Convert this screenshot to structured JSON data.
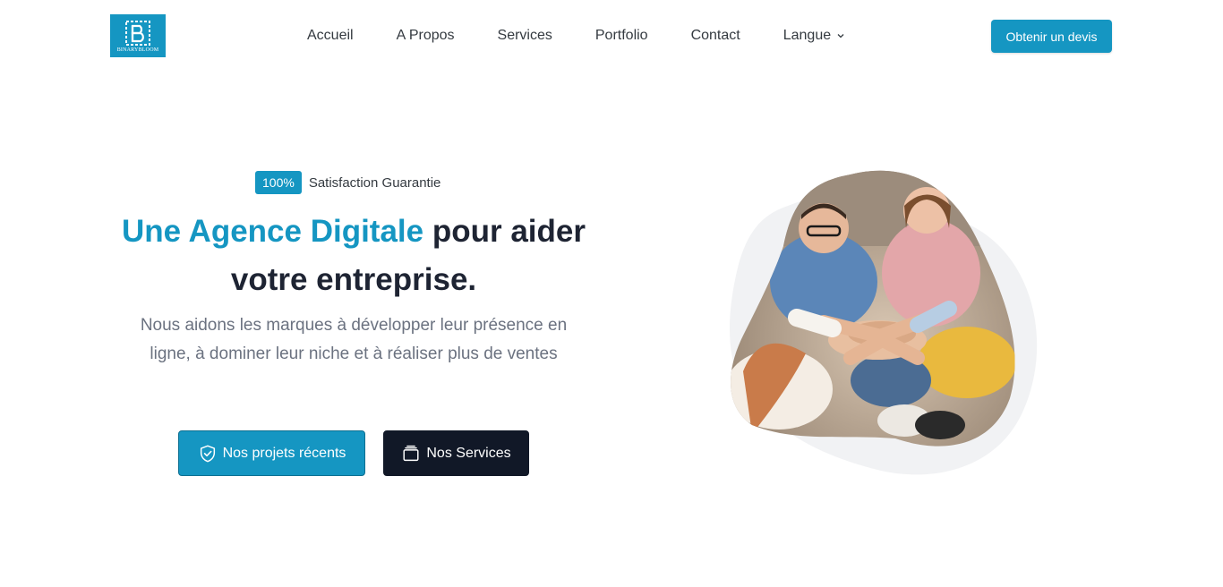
{
  "brand": {
    "logo_text": "BINARYBLOOM",
    "color": "#1596c2"
  },
  "nav": {
    "items": [
      "Accueil",
      "A Propos",
      "Services",
      "Portfolio",
      "Contact"
    ],
    "language_label": "Langue",
    "language_icon": "chevron-down-icon"
  },
  "header": {
    "cta_label": "Obtenir un devis"
  },
  "hero": {
    "badge": "100%",
    "badge_label": "Satisfaction Guarantie",
    "title_accent": "Une Agence Digitale",
    "title_rest_line1": " pour aider",
    "title_line2": "votre entreprise.",
    "subtitle_line1": "Nous aidons les marques à développer leur présence en",
    "subtitle_line2": "ligne, à dominer leur niche et à réaliser plus de ventes",
    "primary_button": {
      "label": "Nos projets récents",
      "icon": "shield-check-icon"
    },
    "secondary_button": {
      "label": "Nos Services",
      "icon": "folder-icon"
    },
    "image_icon": "team-photo",
    "colors": {
      "accent": "#1596c2",
      "dark": "#111827",
      "blob_bg": "#f1f2f4"
    }
  }
}
